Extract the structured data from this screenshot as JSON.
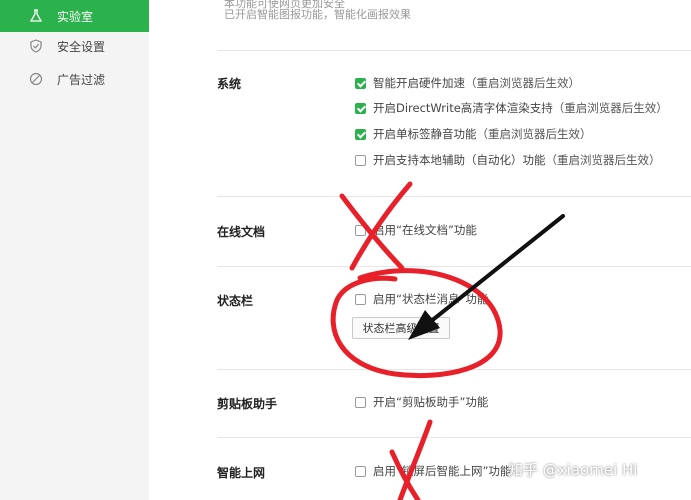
{
  "sidebar": {
    "items": [
      {
        "label": "实验室",
        "icon": "flask-icon",
        "active": true
      },
      {
        "label": "安全设置",
        "icon": "shield-icon",
        "active": false
      },
      {
        "label": "广告过滤",
        "icon": "block-icon",
        "active": false
      }
    ]
  },
  "top_notes": [
    "本功能可使网页更加安全",
    "已开启智能图报功能，智能化画报效果"
  ],
  "sections": {
    "system": {
      "title": "系统",
      "options": [
        {
          "label": "智能开启硬件加速",
          "note": "（重启浏览器后生效）",
          "checked": true
        },
        {
          "label": "开启DirectWrite高清字体渲染支持",
          "note": "（重启浏览器后生效）",
          "checked": true
        },
        {
          "label": "开启单标签静音功能",
          "note": "（重启浏览器后生效）",
          "checked": true
        },
        {
          "label": "开启支持本地辅助（自动化）功能",
          "note": "（重启浏览器后生效）",
          "checked": false
        }
      ]
    },
    "online_docs": {
      "title": "在线文档",
      "option": "启用“在线文档”功能",
      "checked": false
    },
    "status_bar": {
      "title": "状态栏",
      "option": "启用“状态栏消息”功能",
      "checked": false,
      "button": "状态栏高级设置"
    },
    "clipboard": {
      "title": "剪贴板助手",
      "option": "开启“剪贴板助手”功能",
      "checked": false
    },
    "smart_web": {
      "title": "智能上网",
      "option": "启用“锁屏后智能上网”功能",
      "checked": false
    }
  },
  "watermark": "知乎 @xiaomei Hi",
  "colors": {
    "accent": "#2bb24c",
    "annotation": "#e8202a"
  }
}
